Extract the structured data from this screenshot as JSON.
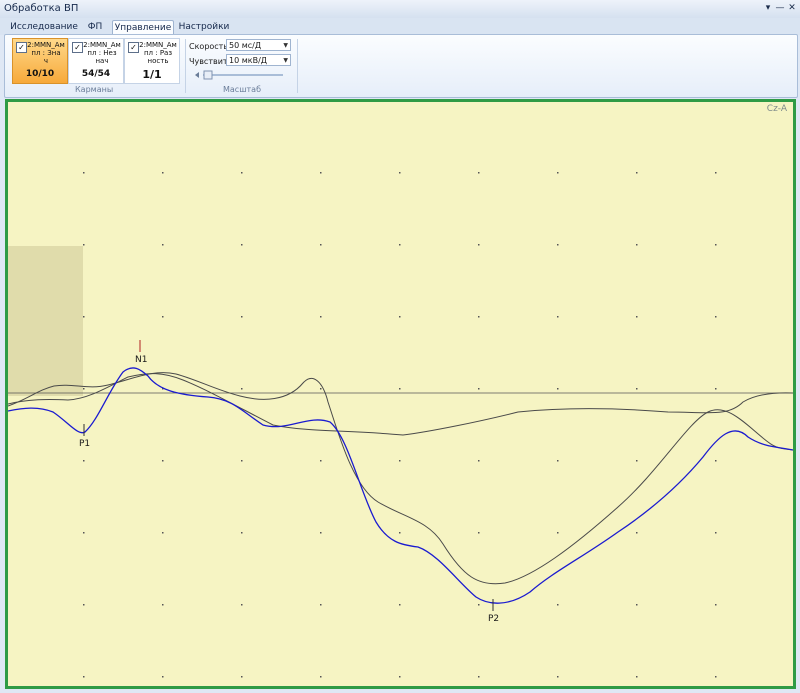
{
  "window": {
    "title": "Обработка ВП"
  },
  "title_controls": [
    "▾",
    "—",
    "✕"
  ],
  "tabs": [
    {
      "label": "Исследование",
      "active": false
    },
    {
      "label": "ФП",
      "active": false
    },
    {
      "label": "Управление",
      "active": true
    },
    {
      "label": "Настройки",
      "active": false
    }
  ],
  "pockets": {
    "group_label": "Карманы",
    "items": [
      {
        "label": "2:MMN_Ам\nпл : Зна\nч",
        "count": "10/10",
        "checked": "✓",
        "active": true
      },
      {
        "label": "2:MMN_Ам\nпл : Нез\nнач",
        "count": "54/54",
        "checked": "✓",
        "active": false
      },
      {
        "label": "2:MMN_Ам\nпл : Раз\nность",
        "count": "1/1",
        "checked": "✓",
        "active": false
      }
    ]
  },
  "scale": {
    "group_label": "Масштаб",
    "speed_label": "Скорость",
    "speed_value": "50 мс/Д",
    "sens_label": "Чувствит.",
    "sens_value": "10 мкВ/Д"
  },
  "plot": {
    "channel": "Cz-A",
    "peaks": [
      {
        "label": "N1"
      },
      {
        "label": "P1"
      },
      {
        "label": "P2"
      }
    ],
    "colors": {
      "background": "#f6f4c3",
      "border": "#2f9b45",
      "blue_trace": "#1a1ad0",
      "gray_trace": "#505050"
    }
  }
}
